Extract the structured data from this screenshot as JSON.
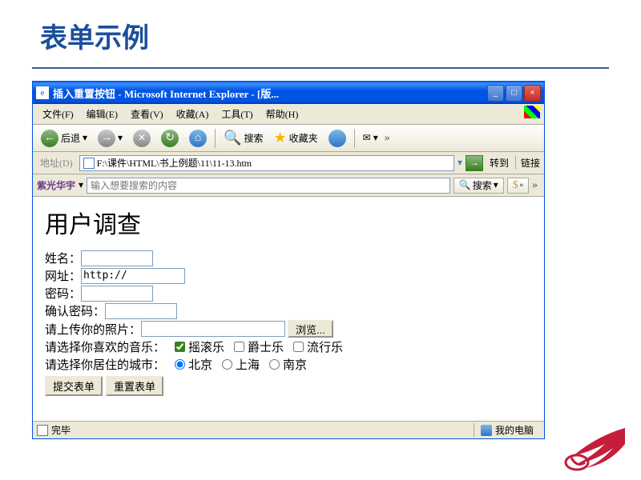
{
  "slide": {
    "title": "表单示例"
  },
  "window": {
    "title": "插入重置按钮 - Microsoft Internet Explorer - [版...",
    "min": "_",
    "max": "□",
    "close": "×"
  },
  "menubar": {
    "file": "文件(F)",
    "edit": "编辑(E)",
    "view": "查看(V)",
    "favorites": "收藏(A)",
    "tools": "工具(T)",
    "help": "帮助(H)"
  },
  "toolbar": {
    "back": "后退",
    "search": "搜索",
    "favorites": "收藏夹"
  },
  "addressbar": {
    "label": "地址(D)",
    "url": "F:\\课件\\HTML\\书上例题\\11\\11-13.htm",
    "goto": "转到",
    "links": "链接"
  },
  "searchbar": {
    "brand": "紫光华宇",
    "placeholder": "输入想要搜索的内容",
    "search": "搜索"
  },
  "page": {
    "heading": "用户调查",
    "name_label": "姓名：",
    "url_label": "网址：",
    "url_value": "http://",
    "password_label": "密码：",
    "confirm_label": "确认密码：",
    "upload_label": "请上传你的照片：",
    "browse": "浏览...",
    "music_label": "请选择你喜欢的音乐：",
    "music_rock": "摇滚乐",
    "music_jazz": "爵士乐",
    "music_pop": "流行乐",
    "city_label": "请选择你居住的城市：",
    "city_bj": "北京",
    "city_sh": "上海",
    "city_nj": "南京",
    "submit": "提交表单",
    "reset": "重置表单"
  },
  "statusbar": {
    "done": "完毕",
    "zone": "我的电脑"
  }
}
